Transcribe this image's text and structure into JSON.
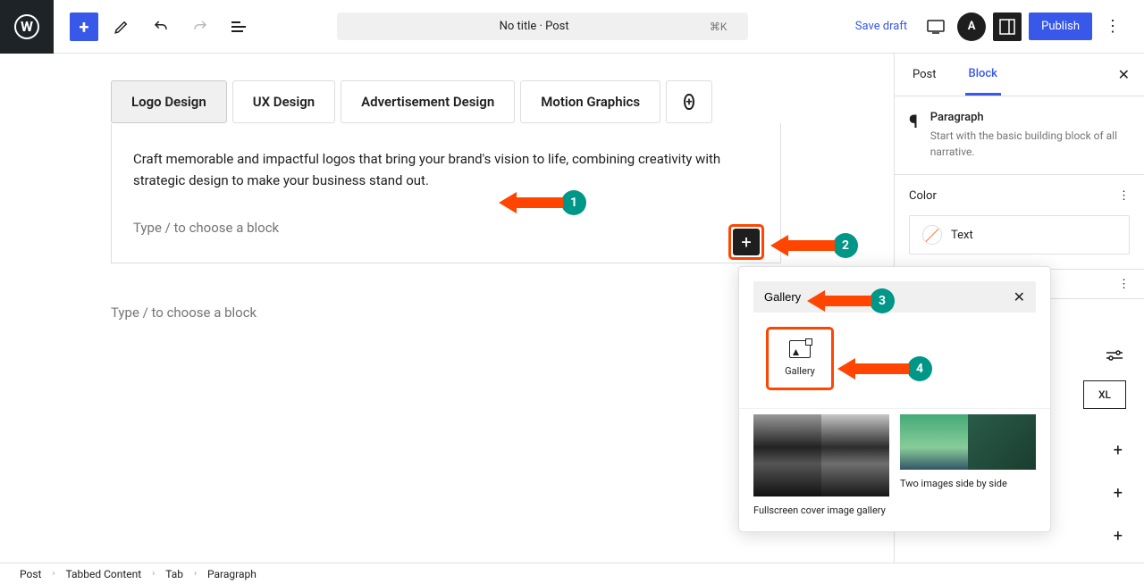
{
  "toolbar": {
    "title": "No title · Post",
    "shortcut": "⌘K",
    "save_draft": "Save draft",
    "publish": "Publish"
  },
  "tabs": {
    "items": [
      "Logo Design",
      "UX Design",
      "Advertisement Design",
      "Motion Graphics"
    ],
    "active_index": 0
  },
  "content": {
    "paragraph": "Craft memorable and impactful logos that bring your brand's vision to life, combining creativity with strategic design to make your business stand out.",
    "placeholder": "Type / to choose a block"
  },
  "sidebar": {
    "tabs": {
      "post": "Post",
      "block": "Block"
    },
    "block_name": "Paragraph",
    "block_desc": "Start with the basic building block of all narrative.",
    "color_section": "Color",
    "color_text": "Text",
    "size_xl": "XL"
  },
  "inserter": {
    "search_value": "Gallery",
    "result_label": "Gallery",
    "pattern1": "Fullscreen cover image gallery",
    "pattern2": "Two images side by side"
  },
  "breadcrumb": [
    "Post",
    "Tabbed Content",
    "Tab",
    "Paragraph"
  ],
  "annotations": [
    "1",
    "2",
    "3",
    "4"
  ]
}
